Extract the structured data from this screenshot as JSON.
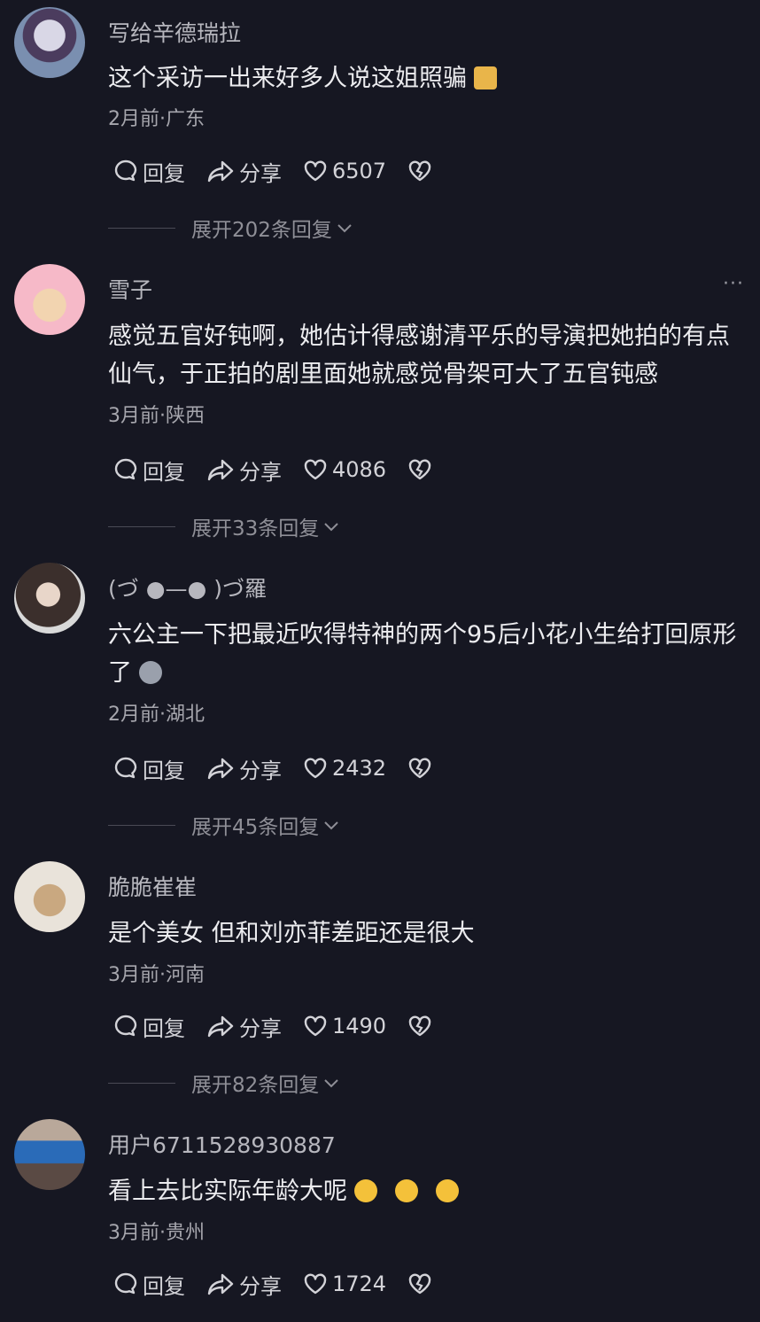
{
  "actions": {
    "reply": "回复",
    "share": "分享"
  },
  "comments": [
    {
      "username": "写给辛德瑞拉",
      "text": "这个采访一出来好多人说这姐照骗",
      "meta": "2月前·广东",
      "likes": "6507",
      "expand": "展开202条回复"
    },
    {
      "username": "雪子",
      "text": "感觉五官好钝啊，她估计得感谢清平乐的导演把她拍的有点仙气，于正拍的剧里面她就感觉骨架可大了五官钝感",
      "meta": "3月前·陕西",
      "likes": "4086",
      "expand": "展开33条回复",
      "more": "···"
    },
    {
      "username": "(づ ●—● )づ羅",
      "text": "六公主一下把最近吹得特神的两个95后小花小生给打回原形了",
      "meta": "2月前·湖北",
      "likes": "2432",
      "expand": "展开45条回复"
    },
    {
      "username": "脆脆崔崔",
      "text": "是个美女 但和刘亦菲差距还是很大",
      "meta": "3月前·河南",
      "likes": "1490",
      "expand": "展开82条回复"
    },
    {
      "username": "用户6711528930887",
      "text": "看上去比实际年龄大呢",
      "meta": "3月前·贵州",
      "likes": "1724"
    }
  ]
}
